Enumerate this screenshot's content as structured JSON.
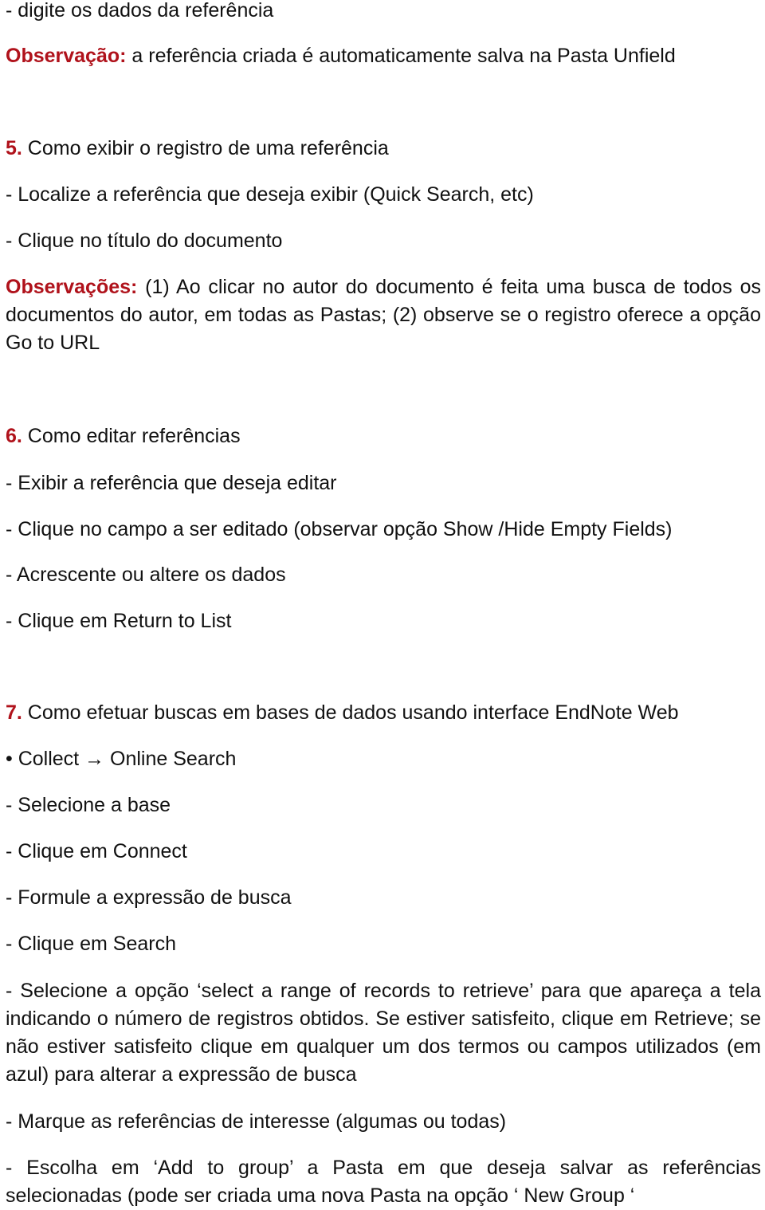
{
  "colors": {
    "accent_red": "#b0121b",
    "text": "#111111",
    "background": "#ffffff"
  },
  "intro": {
    "line1": "- digite os dados da referência",
    "obs_label": "Observação:",
    "obs_text": " a referência criada é automaticamente salva na Pasta Unfield"
  },
  "section5": {
    "number": "5.",
    "title": " Como exibir o registro de uma referência",
    "steps": [
      "- Localize a referência que deseja exibir (Quick Search, etc)",
      "- Clique no título do documento"
    ],
    "obs_label": "Observações:",
    "obs_text": " (1) Ao clicar no autor do documento é feita uma busca de todos os documentos do autor, em todas as Pastas; (2) observe se o registro oferece a opção Go to URL"
  },
  "section6": {
    "number": "6.",
    "title": " Como editar referências",
    "steps": [
      "- Exibir a referência que deseja editar",
      "- Clique no campo a ser editado (observar opção Show /Hide Empty Fields)",
      "- Acrescente ou altere os dados",
      "- Clique em Return to List"
    ]
  },
  "section7": {
    "number": "7.",
    "title": " Como efetuar buscas em bases de dados usando interface EndNote Web",
    "bullet": "• Collect → Online Search",
    "steps": [
      "- Selecione a base",
      "- Clique em Connect",
      "- Formule a expressão de busca",
      "- Clique em Search"
    ],
    "para1": "- Selecione a opção ‘select a range of records to retrieve’ para que apareça a tela indicando o número de registros obtidos. Se estiver satisfeito, clique em Retrieve; se não estiver satisfeito clique em qualquer um dos termos ou campos utilizados (em azul) para alterar a expressão de busca",
    "para2": "- Marque as referências de interesse (algumas ou todas)",
    "para3": "- Escolha em ‘Add to group’ a Pasta em que deseja salvar as referências selecionadas (pode ser criada uma nova Pasta na opção ‘ New Group ‘"
  }
}
